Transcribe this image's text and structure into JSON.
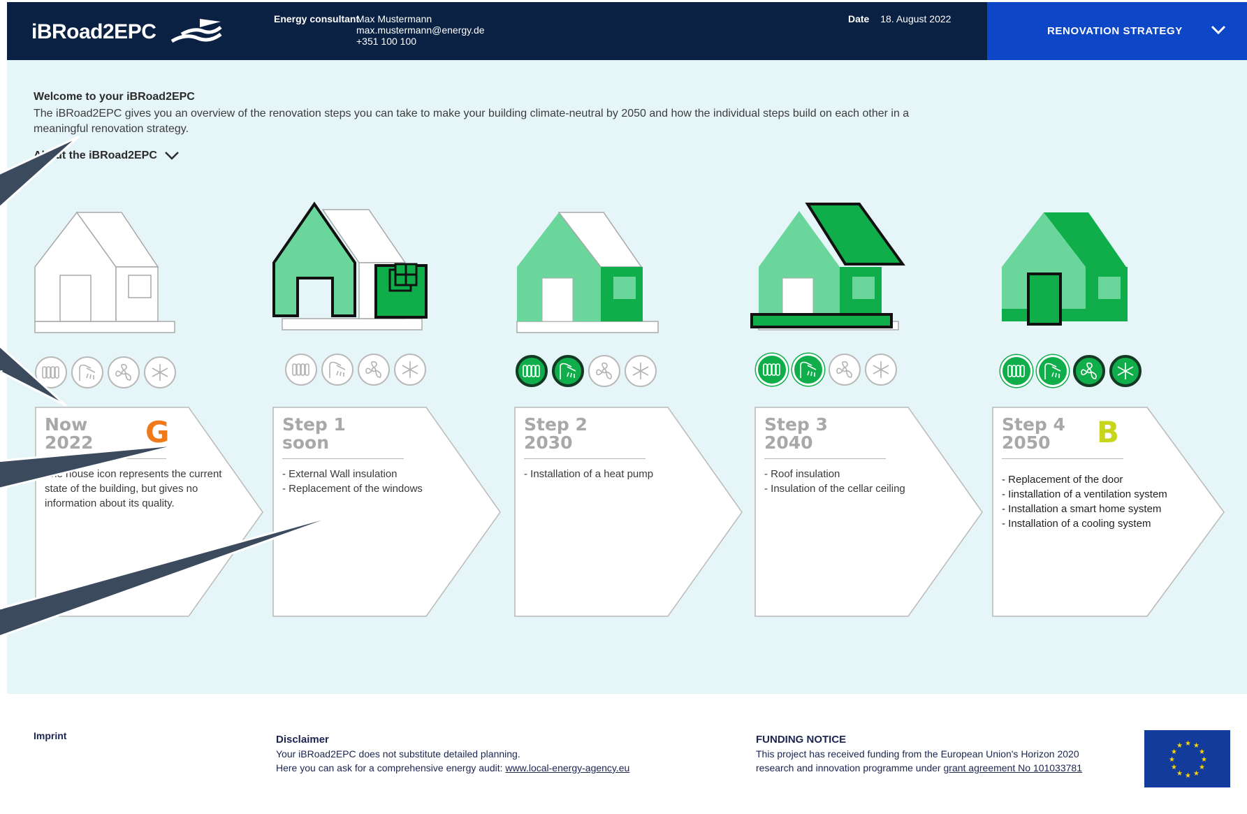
{
  "header": {
    "logo_text": "iBRoad2EPC",
    "consultant_label": "Energy consultant",
    "consultant_name": "Max Mustermann",
    "consultant_email": "max.mustermann@energy.de",
    "consultant_phone": "+351 100 100",
    "date_label": "Date",
    "date_value": "18. August 2022",
    "strategy_label": "RENOVATION STRATEGY"
  },
  "welcome": {
    "title": "Welcome to your iBRoad2EPC",
    "text": "The iBRoad2EPC gives you an overview of the renovation steps you can take to make your building climate-neutral by 2050 and how the individual steps build on each other in a meaningful renovation strategy.",
    "about_label": "About the iBRoad2EPC"
  },
  "service_icons": [
    "radiator-icon",
    "shower-icon",
    "fan-icon",
    "snowflake-icon"
  ],
  "colors": {
    "navy": "#0b2143",
    "blue_accent": "#0d47c7",
    "panel_bg": "#e6f6f8",
    "green_light": "#6bd69c",
    "green": "#0fae4a",
    "grade_g": "#f07a1a",
    "grade_b": "#c7d61c"
  },
  "steps": [
    {
      "title": "Now",
      "year": "2022",
      "grade": "G",
      "items": [
        "The house icon represents the current state of the building, but gives no information about its quality."
      ]
    },
    {
      "title": "Step 1",
      "year": "soon",
      "grade": "",
      "items": [
        "- External Wall insulation",
        "- Replacement of the windows"
      ]
    },
    {
      "title": "Step 2",
      "year": "2030",
      "grade": "",
      "items": [
        "- Installation of a heat pump"
      ]
    },
    {
      "title": "Step 3",
      "year": "2040",
      "grade": "",
      "items": [
        "- Roof insulation",
        "- Insulation of the cellar ceiling"
      ]
    },
    {
      "title": "Step 4",
      "year": "2050",
      "grade": "B",
      "items": [
        "- Replacement of the door",
        "- Iinstallation of a ventilation system",
        "- Installation a smart home system",
        "- Installation of a cooling system"
      ]
    }
  ],
  "footer": {
    "imprint": "Imprint",
    "disclaimer_title": "Disclaimer",
    "disclaimer_line1": "Your iBRoad2EPC does not substitute detailed planning.",
    "disclaimer_line2": "Here you can ask for a comprehensive energy audit:",
    "disclaimer_link": "www.local-energy-agency.eu",
    "funding_title": "FUNDING NOTICE",
    "funding_line1": "This project has received funding from the European Union's Horizon 2020",
    "funding_line2": "research and innovation programme under",
    "funding_link": "grant agreement No 101033781"
  }
}
